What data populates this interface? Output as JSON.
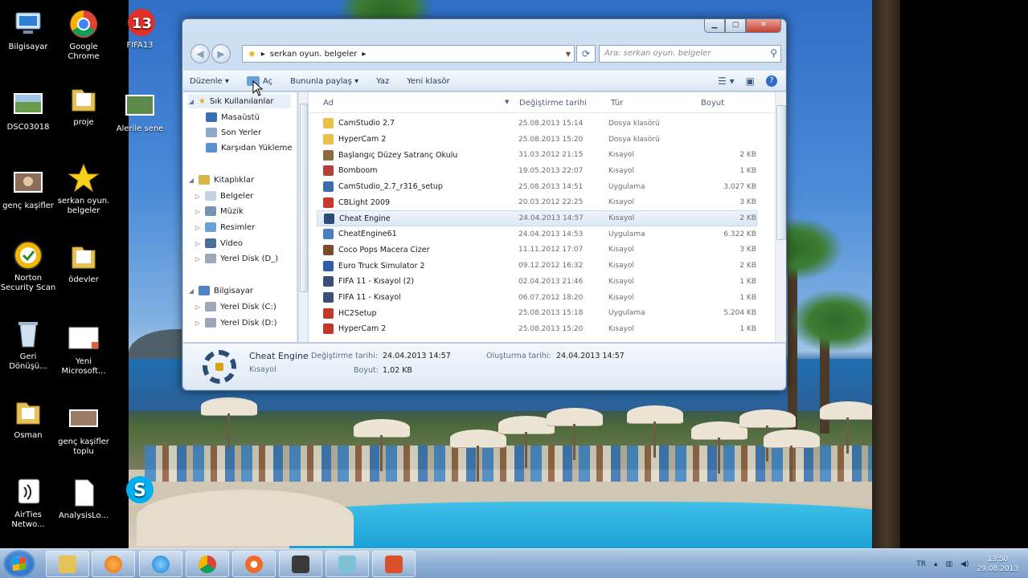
{
  "desktop": {
    "icons_left": [
      {
        "label": "Bilgisayar",
        "icon": "computer-icon"
      },
      {
        "label": "DSC03018",
        "icon": "photo-icon"
      },
      {
        "label": "genç kaşifler",
        "icon": "photo-icon"
      },
      {
        "label": "Norton\nSecurity Scan",
        "icon": "norton-icon"
      },
      {
        "label": "Geri\nDönüşü...",
        "icon": "recycle-bin-icon"
      },
      {
        "label": "Osman",
        "icon": "folder-icon"
      },
      {
        "label": "AirTies\nNetwo...",
        "icon": "airties-icon"
      }
    ],
    "icons_mid": [
      {
        "label": "Google\nChrome",
        "icon": "chrome-icon"
      },
      {
        "label": "proje",
        "icon": "folder-icon"
      },
      {
        "label": "serkan oyun.\nbelgeler",
        "icon": "star-icon"
      },
      {
        "label": "ödevler",
        "icon": "folder-icon"
      },
      {
        "label": "Yeni\nMicrosoft...",
        "icon": "document-icon"
      },
      {
        "label": "genç kaşifler\ntoplu",
        "icon": "photo-icon"
      },
      {
        "label": "AnalysisLo...",
        "icon": "document-icon"
      }
    ],
    "icons_right": [
      {
        "label": "FIFA13",
        "icon": "fifa-icon"
      },
      {
        "label": "Alerile sene",
        "icon": "photo-icon"
      },
      {
        "label": "",
        "icon": "skype-icon"
      }
    ]
  },
  "explorer": {
    "address": {
      "path_root": "▸",
      "folder": "serkan oyun. belgeler",
      "chevron": "▸"
    },
    "search_placeholder": "Ara: serkan oyun. belgeler",
    "toolbar": {
      "organize": "Düzenle ▾",
      "open": "Aç",
      "share": "Bununla paylaş ▾",
      "burn": "Yaz",
      "new_folder": "Yeni klasör"
    },
    "nav": {
      "favorites": "Sık Kullanılanlar",
      "desktop": "Masaüstü",
      "recent": "Son Yerler",
      "downloads": "Karşıdan Yükleme",
      "libraries": "Kitaplıklar",
      "documents": "Belgeler",
      "music": "Müzik",
      "pictures": "Resimler",
      "video": "Video",
      "newdisk_d_lib": "Yerel Disk (D_)",
      "computer": "Bilgisayar",
      "disk_c": "Yerel Disk (C:)",
      "disk_d": "Yerel Disk (D:)"
    },
    "columns": {
      "name": "Ad",
      "date": "Değiştirme tarihi",
      "type": "Tür",
      "size": "Boyut"
    },
    "files": [
      {
        "name": "CamStudio 2.7",
        "date": "25.08.2013 15:14",
        "type": "Dosya klasörü",
        "size": "",
        "color": "#e8c14a"
      },
      {
        "name": "HyperCam 2",
        "date": "25.08.2013 15:20",
        "type": "Dosya klasörü",
        "size": "",
        "color": "#e8c14a"
      },
      {
        "name": "Başlangıç Düzey Satranç Okulu",
        "date": "31.03.2012 21:15",
        "type": "Kısayol",
        "size": "2 KB",
        "color": "#8e6a3c"
      },
      {
        "name": "Bomboom",
        "date": "19.05.2013 22:07",
        "type": "Kısayol",
        "size": "1 KB",
        "color": "#b3403a"
      },
      {
        "name": "CamStudio_2.7_r316_setup",
        "date": "25.08.2013 14:51",
        "type": "Uygulama",
        "size": "3.027 KB",
        "color": "#3d6db0"
      },
      {
        "name": "CBLight 2009",
        "date": "20.03.2012 22:25",
        "type": "Kısayol",
        "size": "3 KB",
        "color": "#c43a2f"
      },
      {
        "name": "Cheat Engine",
        "date": "24.04.2013 14:57",
        "type": "Kısayol",
        "size": "2 KB",
        "color": "#2c4d76"
      },
      {
        "name": "CheatEngine61",
        "date": "24.04.2013 14:53",
        "type": "Uygulama",
        "size": "6.322 KB",
        "color": "#4a7fc0"
      },
      {
        "name": "Coco Pops Macera Cizer",
        "date": "11.11.2012 17:07",
        "type": "Kısayol",
        "size": "3 KB",
        "color": "#7a4a2a"
      },
      {
        "name": "Euro Truck Simulator 2",
        "date": "09.12.2012 16:32",
        "type": "Kısayol",
        "size": "2 KB",
        "color": "#2f5ea8"
      },
      {
        "name": "FIFA 11 - Kısayol (2)",
        "date": "02.04.2013 21:46",
        "type": "Kısayol",
        "size": "1 KB",
        "color": "#3a4f7a"
      },
      {
        "name": "FIFA 11 - Kısayol",
        "date": "06.07.2012 18:20",
        "type": "Kısayol",
        "size": "1 KB",
        "color": "#3a4f7a"
      },
      {
        "name": "HC2Setup",
        "date": "25.08.2013 15:18",
        "type": "Uygulama",
        "size": "5.204 KB",
        "color": "#c0392b"
      },
      {
        "name": "HyperCam 2",
        "date": "25.08.2013 15:20",
        "type": "Kısayol",
        "size": "1 KB",
        "color": "#c0392b"
      }
    ],
    "details": {
      "name": "Cheat Engine",
      "type": "Kısayol",
      "modified_label": "Değiştirme tarihi:",
      "modified": "24.04.2013 14:57",
      "created_label": "Oluşturma tarihi:",
      "created": "24.04.2013 14:57",
      "size_label": "Boyut:",
      "size": "1,02 KB"
    }
  },
  "taskbar": {
    "tray_lang": "TR",
    "time": "13:50",
    "date": "29.08.2013"
  }
}
